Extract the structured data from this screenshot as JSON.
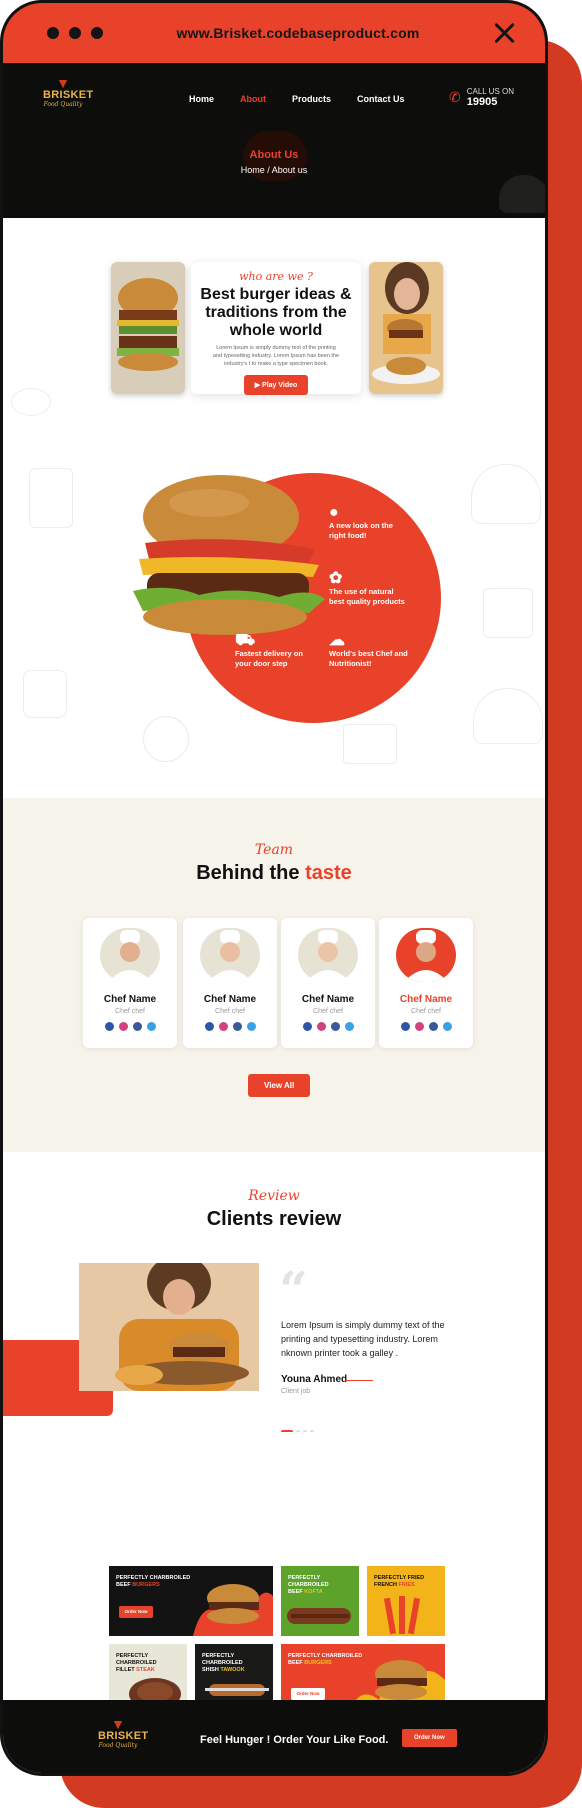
{
  "browser": {
    "url": "www.Brisket.codebaseproduct.com"
  },
  "brand": {
    "name": "BRISKET",
    "tagline": "Food Quality"
  },
  "nav": {
    "items": [
      "Home",
      "About",
      "Products",
      "Contact Us"
    ],
    "active": "About"
  },
  "call": {
    "label": "CALL US ON",
    "number": "19905"
  },
  "hero": {
    "title": "About Us",
    "breadcrumb": "Home / About us"
  },
  "about": {
    "kicker": "who are we ?",
    "title": "Best burger ideas & traditions from the whole world",
    "text": "Lorem Ipsum is simply dummy text of the printing and typesetting industry. Lorem Ipsum has been the industry's t to make a type specimen book.",
    "button": "Play Video"
  },
  "features": [
    {
      "icon": "burger-icon",
      "text": "A new look on the right food!"
    },
    {
      "icon": "leaf-icon",
      "text": "The use of natural best quality products"
    },
    {
      "icon": "delivery-icon",
      "text": "Fastest delivery on your door step"
    },
    {
      "icon": "chef-hat-icon",
      "text": "World's best Chef and Nutritionist!"
    }
  ],
  "team": {
    "kicker": "Team",
    "title_plain": "Behind the",
    "title_accent": "taste",
    "chefs": [
      {
        "name": "Chef Name",
        "role": "Chef chef"
      },
      {
        "name": "Chef Name",
        "role": "Chef chef"
      },
      {
        "name": "Chef Name",
        "role": "Chef chef"
      },
      {
        "name": "Chef Name",
        "role": "Chef chef"
      }
    ],
    "button": "View All"
  },
  "review": {
    "kicker": "Review",
    "title": "Clients review",
    "text": "Lorem Ipsum is simply dummy text of the printing and typesetting industry. Lorem nknown printer took a galley .",
    "author": "Youna Ahmed",
    "job": "Client job"
  },
  "promos": [
    {
      "line1": "PERFECTLY CHARBROILED",
      "line2a": "BEEF ",
      "line2b": "BURGERS",
      "button": "Order Now"
    },
    {
      "line1": "PERFECTLY CHARBROILED",
      "line2a": "BEEF ",
      "line2b": "KOFTA",
      "button": ""
    },
    {
      "line1": "PERFECTLY FRIED",
      "line2a": "FRENCH ",
      "line2b": "FRIES",
      "button": ""
    },
    {
      "line1": "PERFECTLY CHARBROILED",
      "line2a": "FILLET ",
      "line2b": "STEAK",
      "button": ""
    },
    {
      "line1": "PERFECTLY CHARBROILED",
      "line2a": "SHISH ",
      "line2b": "TAWOOK",
      "button": ""
    },
    {
      "line1": "PERFECTLY CHARBROILED",
      "line2a": "BEEF ",
      "line2b": "BURGERS",
      "button": "Order Now"
    }
  ],
  "footer": {
    "tagline": "Feel Hunger ! Order Your Like Food.",
    "button": "Order Now"
  },
  "colors": {
    "accent": "#e8432a",
    "dark": "#0d0d0b",
    "cream": "#f5f3ea"
  }
}
